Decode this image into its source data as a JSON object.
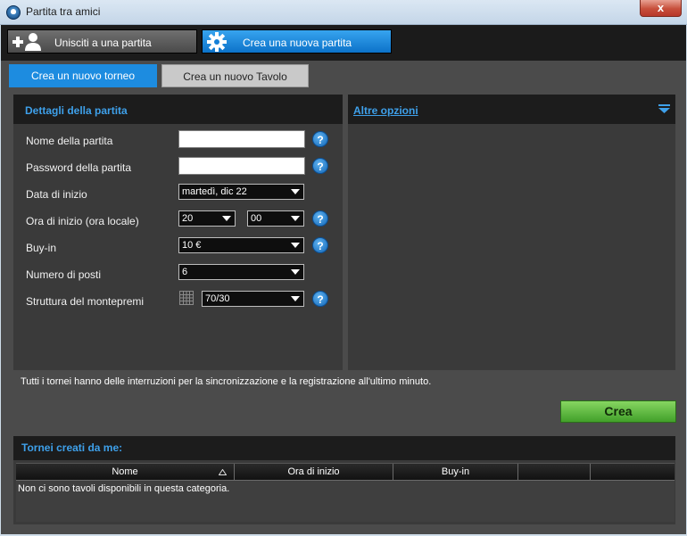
{
  "window": {
    "title": "Partita tra amici",
    "close_glyph": "x"
  },
  "modes": {
    "join_label": "Unisciti a una partita",
    "create_label": "Crea una nuova partita"
  },
  "subtabs": {
    "tournament": "Crea un nuovo torneo",
    "table": "Crea un nuovo Tavolo"
  },
  "details": {
    "title": "Dettagli della partita",
    "name_label": "Nome della partita",
    "name_value": "",
    "password_label": "Password della partita",
    "password_value": "",
    "date_label": "Data di inizio",
    "date_value": "martedì, dic 22",
    "time_label": "Ora di inizio (ora locale)",
    "hour_value": "20",
    "minute_value": "00",
    "buyin_label": "Buy-in",
    "buyin_value": "10 €",
    "seats_label": "Numero di posti",
    "seats_value": "6",
    "prize_label": "Struttura del montepremi",
    "prize_value": "70/30",
    "help_glyph": "?"
  },
  "options": {
    "title": "Altre opzioni"
  },
  "info": "Tutti i tornei hanno delle interruzioni per la sincronizzazione e la registrazione all'ultimo minuto.",
  "create_button": "Crea",
  "list": {
    "title": "Tornei creati da me:",
    "columns": [
      "Nome",
      "Ora di inizio",
      "Buy-in",
      "",
      ""
    ],
    "empty_message": "Non ci sono tavoli disponibili in questa categoria."
  },
  "colors": {
    "accent_blue": "#1d8ce0",
    "title_blue": "#3ea0ea",
    "create_green": "#5bbd3c",
    "panel_dark": "#3a3a3a"
  }
}
